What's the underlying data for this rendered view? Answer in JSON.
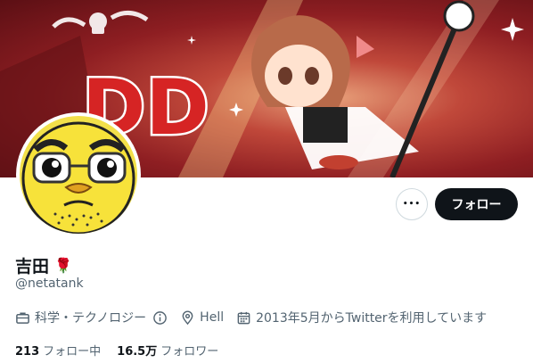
{
  "banner": {
    "logo_text": "DD"
  },
  "profile": {
    "display_name": "吉田",
    "name_emoji": "🌹",
    "handle": "@netatank"
  },
  "actions": {
    "more_label": "•••",
    "follow_label": "フォロー"
  },
  "meta": {
    "category": "科学・テクノロジー",
    "location": "Hell",
    "joined": "2013年5月からTwitterを利用しています"
  },
  "stats": {
    "following_count": "213",
    "following_label": "フォロー中",
    "followers_count": "16.5万",
    "followers_label": "フォロワー"
  },
  "icons": [
    "briefcase-icon",
    "info-icon",
    "location-pin-icon",
    "calendar-icon",
    "more-icon"
  ],
  "colors": {
    "button_dark": "#0f1419",
    "secondary_text": "#536471",
    "banner_red": "#8e1e22"
  }
}
